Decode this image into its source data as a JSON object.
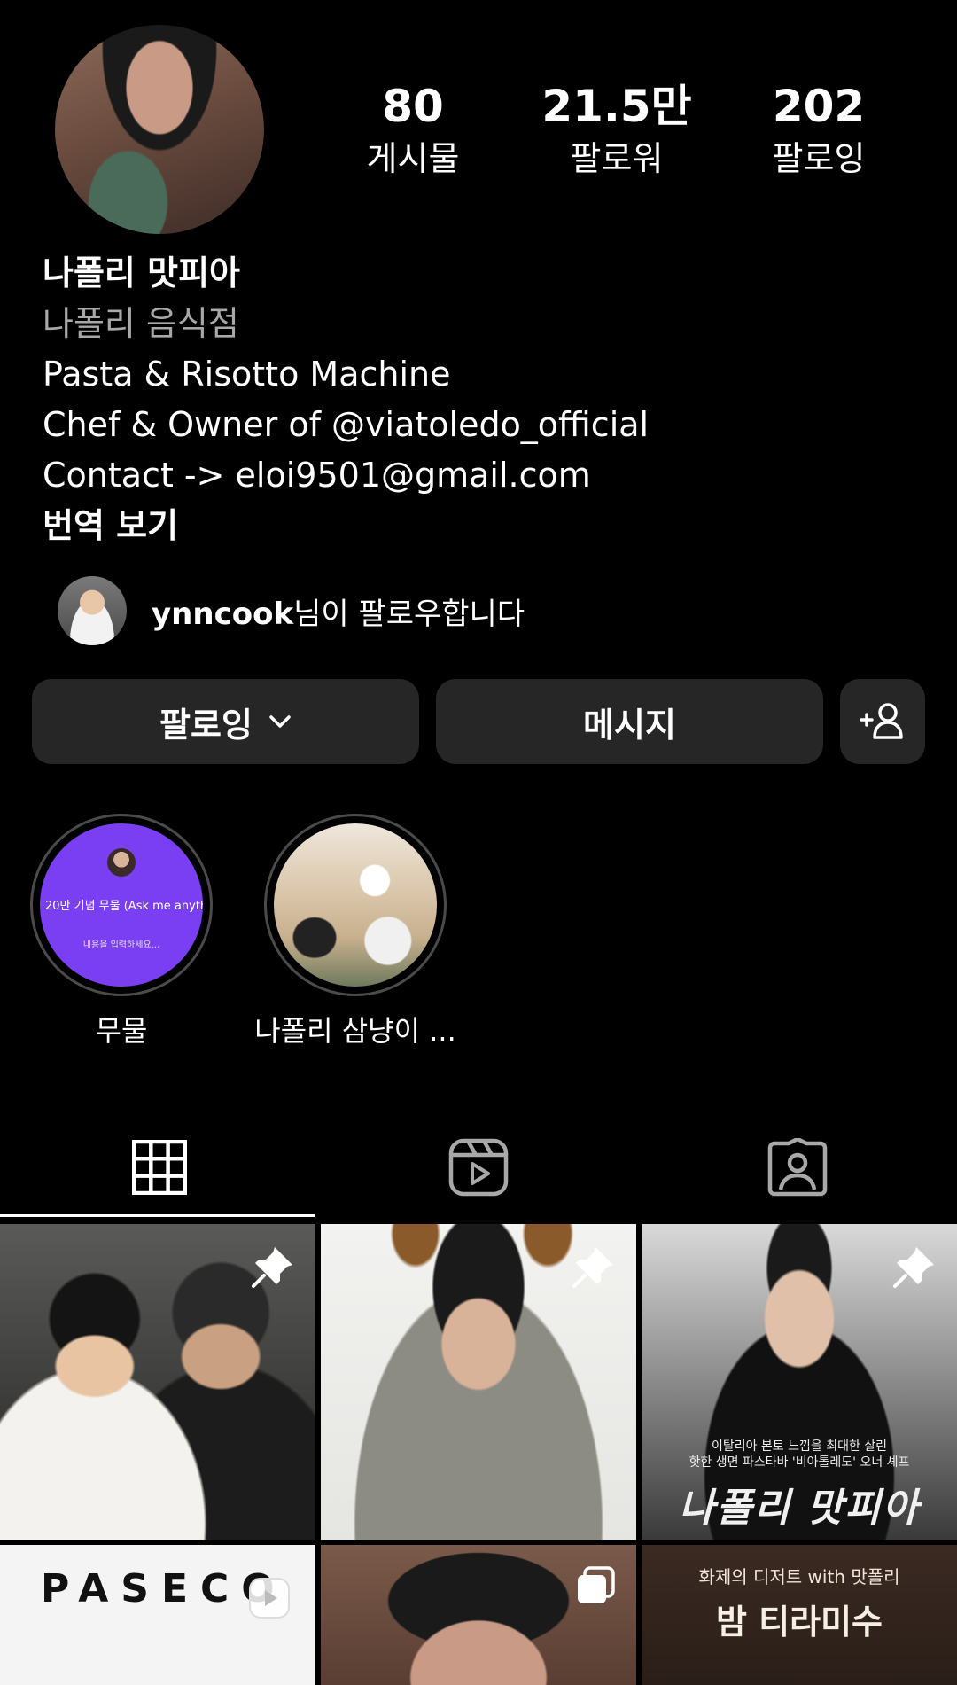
{
  "profile": {
    "stats": [
      {
        "value": "80",
        "label": "게시물"
      },
      {
        "value": "21.5만",
        "label": "팔로워"
      },
      {
        "value": "202",
        "label": "팔로잉"
      }
    ],
    "name": "나폴리 맛피아",
    "category": "나폴리 음식점",
    "bio_lines": [
      "Pasta & Risotto Machine",
      "Chef & Owner of @viatoledo_official",
      "Contact -> eloi9501@gmail.com"
    ],
    "translate_label": "번역 보기"
  },
  "followed_by": {
    "username": "ynncook",
    "suffix": "님이 팔로우합니다"
  },
  "actions": {
    "following_label": "팔로잉",
    "message_label": "메시지"
  },
  "highlights": [
    {
      "label": "무물",
      "cover_title": "20만 기념 무물 (Ask me anything)",
      "cover_sub": "내용을 입력하세요..."
    },
    {
      "label": "나폴리 삼냥이 ..."
    }
  ],
  "tabs": [
    {
      "icon": "grid-icon",
      "selected": true
    },
    {
      "icon": "reels-icon",
      "selected": false
    },
    {
      "icon": "tagged-icon",
      "selected": false
    }
  ],
  "posts": [
    {
      "pinned": true,
      "description_icon": "pin-icon"
    },
    {
      "pinned": true
    },
    {
      "pinned": true,
      "overlay_lines": [
        "이탈리아 본토 느낌을 최대한 살린",
        "핫한 생면 파스타바 '비아톨레도' 오너 셰프"
      ],
      "big_title": "나폴리 맛피아"
    },
    {
      "overlay_title": "PASECO",
      "badge": "reels-icon"
    },
    {
      "badge": "carousel-icon"
    },
    {
      "overlay_lines": [
        "화제의 디저트 with 맛폴리"
      ],
      "big_title": "밤 티라미수"
    }
  ],
  "colors": {
    "background": "#000000",
    "button": "#262626",
    "secondary_text": "#a8a8a8",
    "highlight_purple": "#7a3ff2"
  }
}
